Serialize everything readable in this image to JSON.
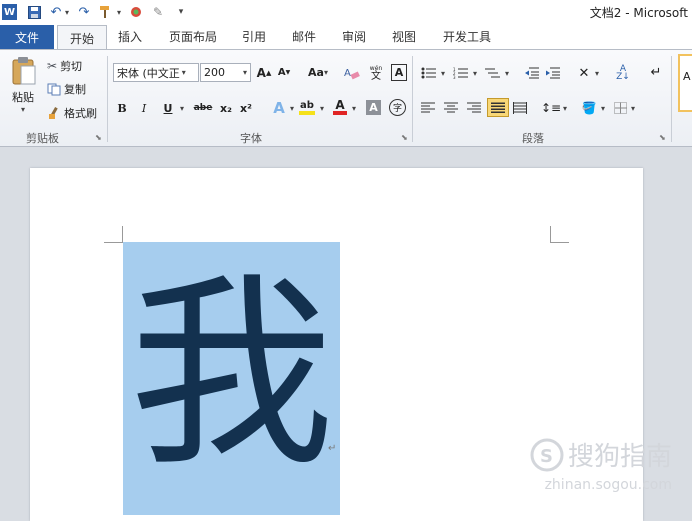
{
  "title_bar": {
    "title": "文档2 - Microsoft",
    "quick_access": [
      "word-icon",
      "save-icon",
      "undo-icon",
      "redo-icon",
      "format-painter-icon",
      "color-icon",
      "draw-icon",
      "customize-icon"
    ]
  },
  "tabs": {
    "file": "文件",
    "items": [
      "开始",
      "插入",
      "页面布局",
      "引用",
      "邮件",
      "审阅",
      "视图",
      "开发工具"
    ],
    "active": "开始"
  },
  "clipboard": {
    "paste": "粘贴",
    "cut": "剪切",
    "copy": "复制",
    "format_painter": "格式刷",
    "group_label": "剪贴板"
  },
  "font": {
    "font_name": "宋体 (中文正",
    "font_size": "200",
    "grow": "A",
    "shrink": "A",
    "change_case": "Aa",
    "bold": "B",
    "italic": "I",
    "underline": "U",
    "strikethrough": "abe",
    "subscript": "x₂",
    "superscript": "x²",
    "text_effects": "A",
    "highlight": "ab",
    "font_color": "A",
    "char_shading": "A",
    "enclose": "字",
    "phonetic": "wén",
    "group_label": "字体"
  },
  "paragraph": {
    "group_label": "段落"
  },
  "styles": {
    "preview": "A"
  },
  "document": {
    "character": "我",
    "paragraph_mark": "↵"
  },
  "watermark": {
    "line1": "搜狗指南",
    "line2": "zhinan.sogou.com"
  },
  "colors": {
    "file_tab": "#2a5fa9",
    "selection": "#a6cdee",
    "glyph": "#13314f",
    "active_align": "#f8d777"
  }
}
